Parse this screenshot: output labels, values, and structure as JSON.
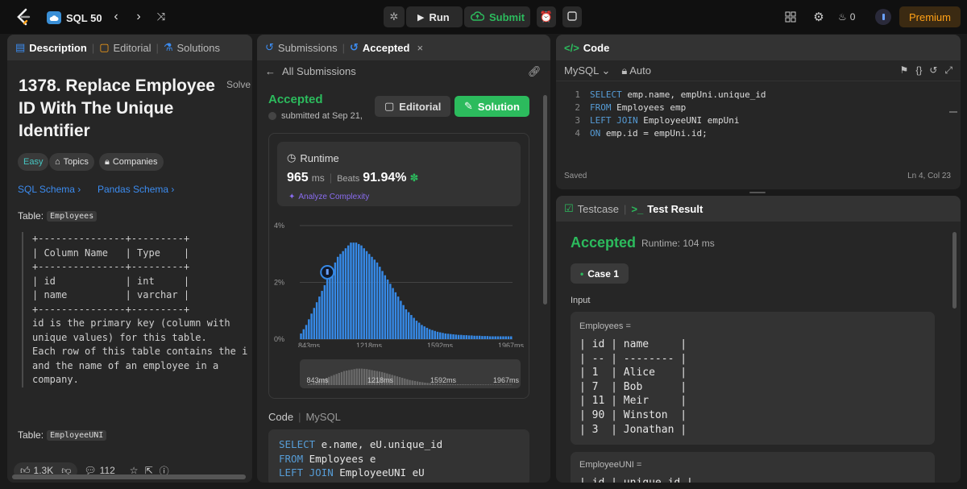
{
  "topbar": {
    "study_plan": "SQL 50",
    "run_label": "Run",
    "submit_label": "Submit",
    "streak_count": "0",
    "premium_label": "Premium"
  },
  "left": {
    "tabs": [
      "Description",
      "Editorial",
      "Solutions"
    ],
    "title": "1378. Replace Employee ID With The Unique Identifier",
    "solved_label": "Solve",
    "difficulty": "Easy",
    "topics_label": "Topics",
    "companies_label": "Companies",
    "schema_links": [
      "SQL Schema",
      "Pandas Schema"
    ],
    "table1_label": "Table:",
    "table1_name": "Employees",
    "schema_text": "+---------------+---------+\n| Column Name   | Type    |\n+---------------+---------+\n| id            | int     |\n| name          | varchar |\n+---------------+---------+\nid is the primary key (column with\nunique values) for this table.\nEach row of this table contains the i\nand the name of an employee in a\ncompany.",
    "table2_label": "Table:",
    "table2_name": "EmployeeUNI",
    "likes": "1.3K",
    "comments": "112"
  },
  "middle": {
    "tabs": [
      "Submissions",
      "Accepted"
    ],
    "back_label": "All Submissions",
    "status": "Accepted",
    "submitted": "submitted at Sep 21,",
    "editorial_label": "Editorial",
    "solution_label": "Solution",
    "runtime_label": "Runtime",
    "runtime_value": "965",
    "runtime_unit": "ms",
    "beats_label": "Beats",
    "beats_value": "91.94%",
    "analyze_label": "Analyze Complexity",
    "code_label": "Code",
    "code_lang": "MySQL",
    "code_lines": [
      "SELECT e.name, eU.unique_id",
      "FROM Employees e",
      "LEFT JOIN EmployeeUNI eU"
    ]
  },
  "chart_data": {
    "type": "bar",
    "title": "",
    "xlabel": "",
    "ylabel": "",
    "y_ticks": [
      "4%",
      "2%",
      "0%"
    ],
    "ylim": [
      0,
      4
    ],
    "x_ticks": [
      "843ms",
      "1218ms",
      "1592ms",
      "1967ms"
    ],
    "x_range": [
      843,
      1967
    ],
    "values": [
      0.2,
      0.35,
      0.5,
      0.7,
      0.9,
      1.1,
      1.3,
      1.5,
      1.7,
      1.9,
      2.1,
      2.3,
      2.5,
      2.7,
      2.9,
      3.0,
      3.1,
      3.2,
      3.3,
      3.4,
      3.4,
      3.4,
      3.35,
      3.3,
      3.2,
      3.1,
      3.0,
      2.9,
      2.8,
      2.7,
      2.55,
      2.4,
      2.25,
      2.1,
      1.95,
      1.8,
      1.65,
      1.5,
      1.35,
      1.2,
      1.05,
      0.95,
      0.85,
      0.75,
      0.65,
      0.58,
      0.5,
      0.45,
      0.4,
      0.35,
      0.32,
      0.29,
      0.26,
      0.24,
      0.22,
      0.2,
      0.19,
      0.18,
      0.17,
      0.16,
      0.15,
      0.15,
      0.14,
      0.14,
      0.13,
      0.13,
      0.12,
      0.12,
      0.12,
      0.11,
      0.11,
      0.11,
      0.1,
      0.1,
      0.1,
      0.1,
      0.1,
      0.1,
      0.1,
      0.1,
      0.1
    ],
    "highlight_index": 10,
    "colors": {
      "bar": "#3689e6",
      "grid": "#444444"
    }
  },
  "code": {
    "title": "Code",
    "lang": "MySQL",
    "mode": "Auto",
    "lines": [
      {
        "n": "1",
        "kw": "SELECT",
        "rest": " emp.name, empUni.unique_id"
      },
      {
        "n": "2",
        "kw": "FROM",
        "rest": " Employees emp"
      },
      {
        "n": "3",
        "kw": "LEFT JOIN",
        "rest": " EmployeeUNI empUni"
      },
      {
        "n": "4",
        "kw": "ON",
        "rest": " emp.id = empUni.id;"
      }
    ],
    "saved": "Saved",
    "position": "Ln 4, Col 23"
  },
  "test": {
    "tabs": [
      "Testcase",
      "Test Result"
    ],
    "status": "Accepted",
    "runtime": "Runtime: 104 ms",
    "case_label": "Case 1",
    "input_label": "Input",
    "table1_name": "Employees =",
    "table1_text": "| id | name     |\n| -- | -------- |\n| 1  | Alice    |\n| 7  | Bob      |\n| 11 | Meir     |\n| 90 | Winston  |\n| 3  | Jonathan |",
    "table2_name": "EmployeeUNI =",
    "table2_text": "| id | unique_id |"
  }
}
